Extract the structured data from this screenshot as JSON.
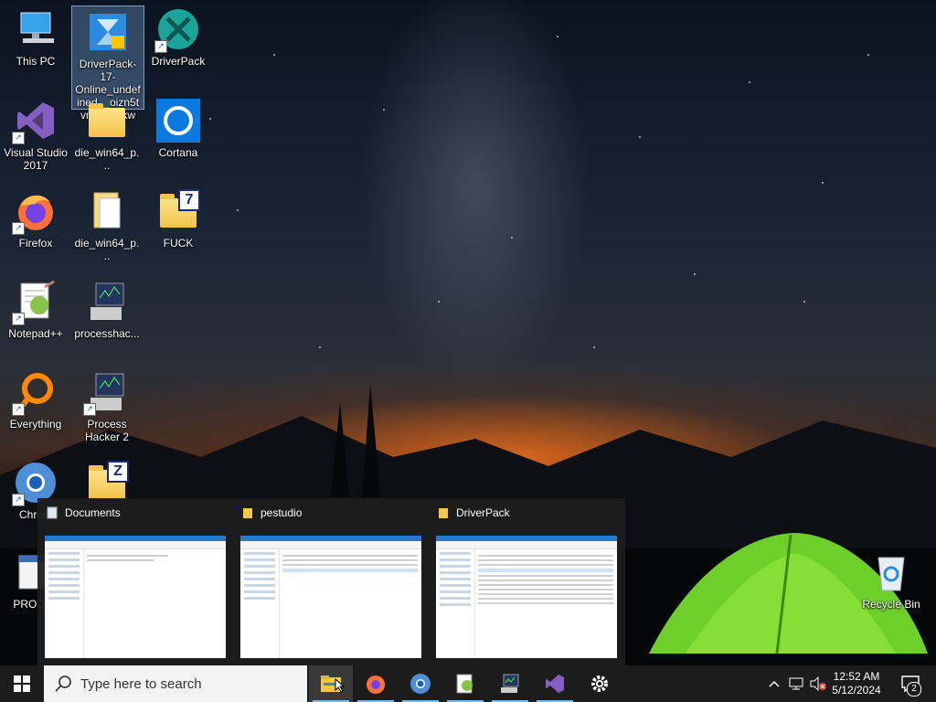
{
  "desktop": {
    "icons": [
      {
        "label": "This PC",
        "icon": "computer-icon"
      },
      {
        "label": "DriverPack-17-Online_undefined__oizn5tvnsaghbkw",
        "icon": "driverpack-installer-icon"
      },
      {
        "label": "DriverPack",
        "icon": "driverpack-icon"
      },
      {
        "label": "Visual Studio 2017",
        "icon": "visual-studio-icon"
      },
      {
        "label": "die_win64_p...",
        "icon": "zip-folder-icon"
      },
      {
        "label": "Cortana",
        "icon": "cortana-icon"
      },
      {
        "label": "Firefox",
        "icon": "firefox-icon"
      },
      {
        "label": "die_win64_p...",
        "icon": "folder-icon"
      },
      {
        "label": "FUCK",
        "icon": "7z-folder-icon"
      },
      {
        "label": "Notepad++",
        "icon": "notepadpp-icon"
      },
      {
        "label": "processhac...",
        "icon": "process-hacker-icon"
      },
      {
        "label": "Everything",
        "icon": "everything-icon"
      },
      {
        "label": "Process Hacker 2",
        "icon": "process-hacker-icon"
      },
      {
        "label": "Chrom",
        "icon": "chromium-icon"
      },
      {
        "label": "PROD_S",
        "icon": "window-icon"
      },
      {
        "label": "Recycle Bin",
        "icon": "recycle-bin-icon"
      }
    ]
  },
  "thumbnails": [
    {
      "title": "Documents"
    },
    {
      "title": "pestudio"
    },
    {
      "title": "DriverPack"
    }
  ],
  "taskbar": {
    "search_placeholder": "Type here to search",
    "apps": [
      "file-explorer",
      "firefox",
      "chromium",
      "notepadpp",
      "process-hacker",
      "visual-studio",
      "settings"
    ]
  },
  "tray": {
    "time": "12:52 AM",
    "date": "5/12/2024",
    "notification_count": "2"
  },
  "colors": {
    "taskbar": "#1c1c1c",
    "accent": "#76b9ed",
    "selection": "#5a8fc8"
  }
}
